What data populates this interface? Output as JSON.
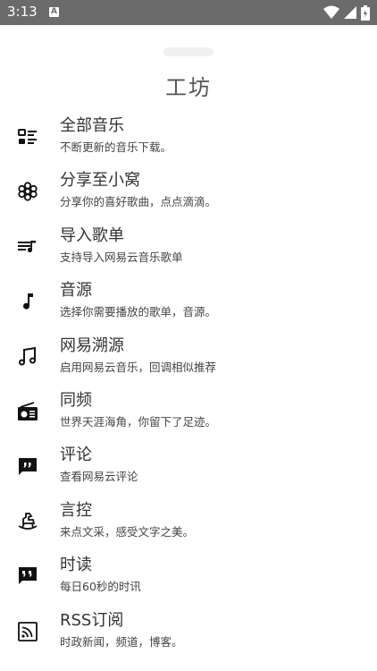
{
  "status_bar": {
    "time": "3:13",
    "notification_glyph": "A",
    "icons": [
      "wifi-icon",
      "signal-icon",
      "battery-icon"
    ]
  },
  "sheet": {
    "title": "工坊"
  },
  "items": [
    {
      "icon": "list-icon",
      "title": "全部音乐",
      "subtitle": "不断更新的音乐下载。"
    },
    {
      "icon": "flower-icon",
      "title": "分享至小窝",
      "subtitle": "分享你的喜好歌曲，点点滴滴。"
    },
    {
      "icon": "playlist-add-icon",
      "title": "导入歌单",
      "subtitle": "支持导入网易云音乐歌单"
    },
    {
      "icon": "music-note-icon",
      "title": "音源",
      "subtitle": "选择你需要播放的歌单，音源。"
    },
    {
      "icon": "double-note-icon",
      "title": "网易溯源",
      "subtitle": "启用网易云音乐，回调相似推荐"
    },
    {
      "icon": "radio-icon",
      "title": "同频",
      "subtitle": "世界天涯海角，你留下了足迹。"
    },
    {
      "icon": "comment-icon",
      "title": "评论",
      "subtitle": "查看网易云评论"
    },
    {
      "icon": "rocking-horse-icon",
      "title": "言控",
      "subtitle": "来点文采，感受文字之美。"
    },
    {
      "icon": "quote-icon",
      "title": "时读",
      "subtitle": "每日60秒的时讯"
    },
    {
      "icon": "rss-icon",
      "title": "RSS订阅",
      "subtitle": "时政新闻，频道，博客。"
    }
  ]
}
